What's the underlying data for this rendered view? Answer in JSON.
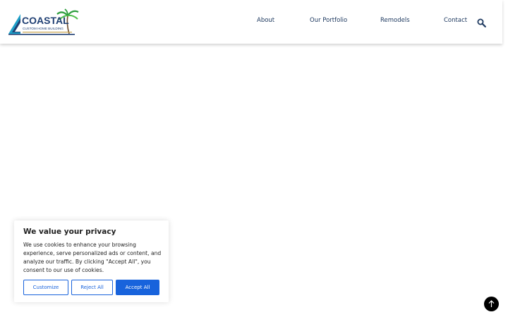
{
  "header": {
    "logo": {
      "brand_name": "COASTAL",
      "tagline": "CUSTOM HOME BUILDING"
    },
    "nav": [
      {
        "label": "About"
      },
      {
        "label": "Our Portfolio"
      },
      {
        "label": "Remodels"
      },
      {
        "label": "Contact"
      }
    ]
  },
  "cookie_banner": {
    "title": "We value your privacy",
    "body": "We use cookies to enhance your browsing experience, serve personalized ads or content, and analyze our traffic. By clicking \"Accept All\", you consent to our use of cookies.",
    "buttons": {
      "customize": "Customize",
      "reject": "Reject All",
      "accept": "Accept All"
    }
  },
  "colors": {
    "nav_text": "#1f3a60",
    "cookie_accent": "#1863dc",
    "logo_navy": "#1f3f73",
    "logo_teal": "#1fa0c8"
  }
}
